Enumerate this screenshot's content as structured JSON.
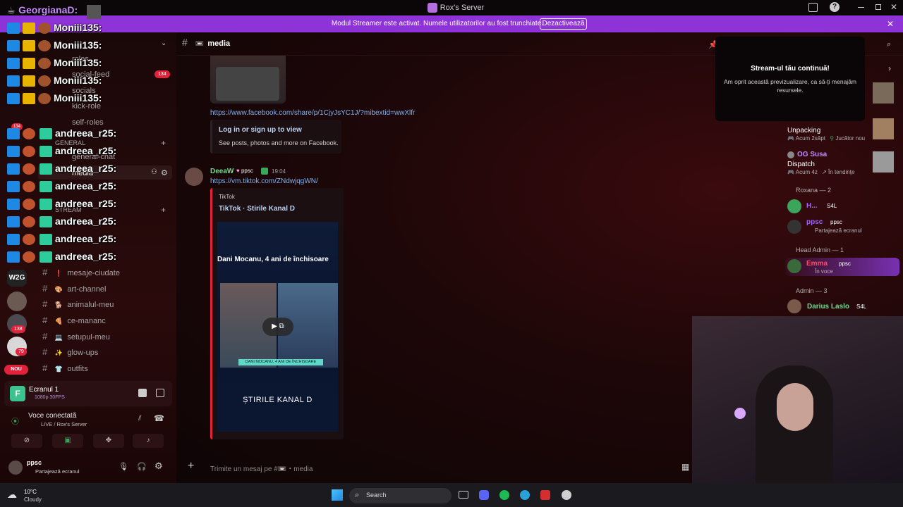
{
  "window": {
    "title": "Rox's Server"
  },
  "streamer_banner": {
    "message": "Modul Streamer este activat. Numele utilizatorilor au fost trunchiate.",
    "button": "Dezactivează"
  },
  "overlay": {
    "top_user": "GeorgianaD:",
    "users": [
      {
        "name": "Moniii135:"
      },
      {
        "name": "Moniii135:"
      },
      {
        "name": "Moniii135:"
      },
      {
        "name": "Moniii135:"
      },
      {
        "name": "Moniii135:"
      },
      {
        "name": "andreea_r25:"
      },
      {
        "name": "andreea_r25:"
      },
      {
        "name": "andreea_r25:"
      },
      {
        "name": "andreea_r25:"
      },
      {
        "name": "andreea_r25:"
      },
      {
        "name": "andreea_r25:"
      },
      {
        "name": "andreea_r25:"
      },
      {
        "name": "andreea_r25:"
      }
    ]
  },
  "server_badges": {
    "b134": "134",
    "b134b": "134",
    "b138": "138",
    "b79": "79",
    "nou": "NOU",
    "w2g": "W2G"
  },
  "channels": {
    "behind": [
      {
        "label": "roles"
      },
      {
        "label": "social-feed"
      },
      {
        "label": "socials"
      },
      {
        "label": "kick-role"
      },
      {
        "label": "self-roles"
      },
      {
        "label": "GENERAL"
      },
      {
        "label": "general-chat"
      },
      {
        "label": "media"
      },
      {
        "label": "STREAM"
      }
    ],
    "visible": [
      {
        "icon": "❗",
        "label": "mesaje-ciudate"
      },
      {
        "icon": "🎨",
        "label": "art-channel"
      },
      {
        "icon": "🐕",
        "label": "animalul-meu"
      },
      {
        "icon": "🍕",
        "label": "ce-mananc"
      },
      {
        "icon": "💻",
        "label": "setupul-meu"
      },
      {
        "icon": "✨",
        "label": "glow-ups"
      },
      {
        "icon": "👕",
        "label": "outfits"
      }
    ]
  },
  "screen_share": {
    "title": "Ecranul 1",
    "quality": "1080p 30FPS"
  },
  "voice": {
    "status": "Voce conectată",
    "where": "LIVE / Rox's Server"
  },
  "user_panel": {
    "name": "ppsc",
    "status": "Partajează ecranul"
  },
  "header": {
    "channel": "media"
  },
  "messages": {
    "link1": "https://www.facebook.com/share/p/1CjyJsYC1J/?mibextid=wwXlfr",
    "embed1_title": "Log in or sign up to view",
    "embed1_desc": "See posts, photos and more on Facebook.",
    "author": "DeeaW",
    "author_tag": "ppsc",
    "time": "19:04",
    "link2": "https://vm.tiktok.com/ZNdwjqgWN/",
    "embed2_provider": "TikTok",
    "embed2_title": "TikTok · Stirile Kanal D",
    "video_headline": "Dani Mocanu, 4 ani de închisoare",
    "video_banner": "DANI MOCANU, 4 ANI DE ÎNCHISOARE",
    "video_logo": "ȘTIRILE KANAL D"
  },
  "composer": {
    "placeholder": "Trimite un mesaj pe #📼・media"
  },
  "tooltip": {
    "title": "Stream-ul tău continuă!",
    "body": "Am oprit această previzualizare, ca să-ți menajăm resursele."
  },
  "members": {
    "top": [
      {
        "name": "Unpacking",
        "sub": "Acum 2săpt",
        "sub2": "Jucător nou"
      },
      {
        "name": "OG Susa",
        "game": "Dispatch",
        "sub": "Acum 4z",
        "sub2": "În tendințe"
      }
    ],
    "groups": [
      {
        "title": "Roxana — 2",
        "items": [
          {
            "name": "H...",
            "tag": "S4L"
          },
          {
            "name": "ppsc",
            "tag": "ppsc",
            "status": "Partajează ecranul"
          }
        ]
      },
      {
        "title": "Head Admin — 1",
        "items": [
          {
            "name": "Emma",
            "tag": "ppsc",
            "status": "În voce"
          }
        ]
      },
      {
        "title": "Admin — 3",
        "items": [
          {
            "name": "Darius Laslo",
            "tag": "S4L"
          }
        ]
      }
    ]
  },
  "taskbar": {
    "temp": "10°C",
    "weather": "Cloudy",
    "search": "Search"
  }
}
